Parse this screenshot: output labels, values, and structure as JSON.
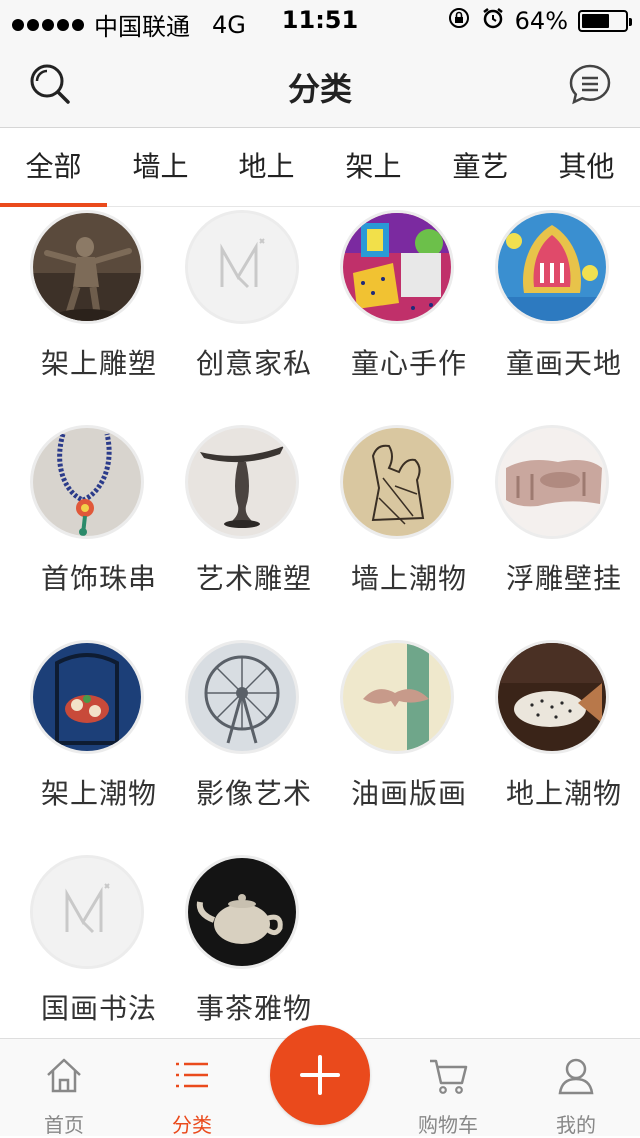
{
  "status_bar": {
    "carrier": "中国联通",
    "network": "4G",
    "time": "11:51",
    "battery_text": "64%",
    "battery_level": 0.64
  },
  "nav": {
    "title": "分类",
    "search_icon": "search-icon",
    "message_icon": "chat-icon"
  },
  "tabs": [
    {
      "label": "全部",
      "active": true
    },
    {
      "label": "墙上"
    },
    {
      "label": "地上"
    },
    {
      "label": "架上"
    },
    {
      "label": "童艺"
    },
    {
      "label": "其他"
    }
  ],
  "categories": [
    {
      "label": "架上雕塑"
    },
    {
      "label": "创意家私"
    },
    {
      "label": "童心手作"
    },
    {
      "label": "童画天地"
    },
    {
      "label": "首饰珠串"
    },
    {
      "label": "艺术雕塑"
    },
    {
      "label": "墙上潮物"
    },
    {
      "label": "浮雕壁挂"
    },
    {
      "label": "架上潮物"
    },
    {
      "label": "影像艺术"
    },
    {
      "label": "油画版画"
    },
    {
      "label": "地上潮物"
    },
    {
      "label": "国画书法"
    },
    {
      "label": "事茶雅物"
    }
  ],
  "tab_bar": {
    "home": "首页",
    "category": "分类",
    "cart": "购物车",
    "mine": "我的"
  },
  "colors": {
    "accent": "#ea4a1c",
    "inactive": "#888888"
  }
}
